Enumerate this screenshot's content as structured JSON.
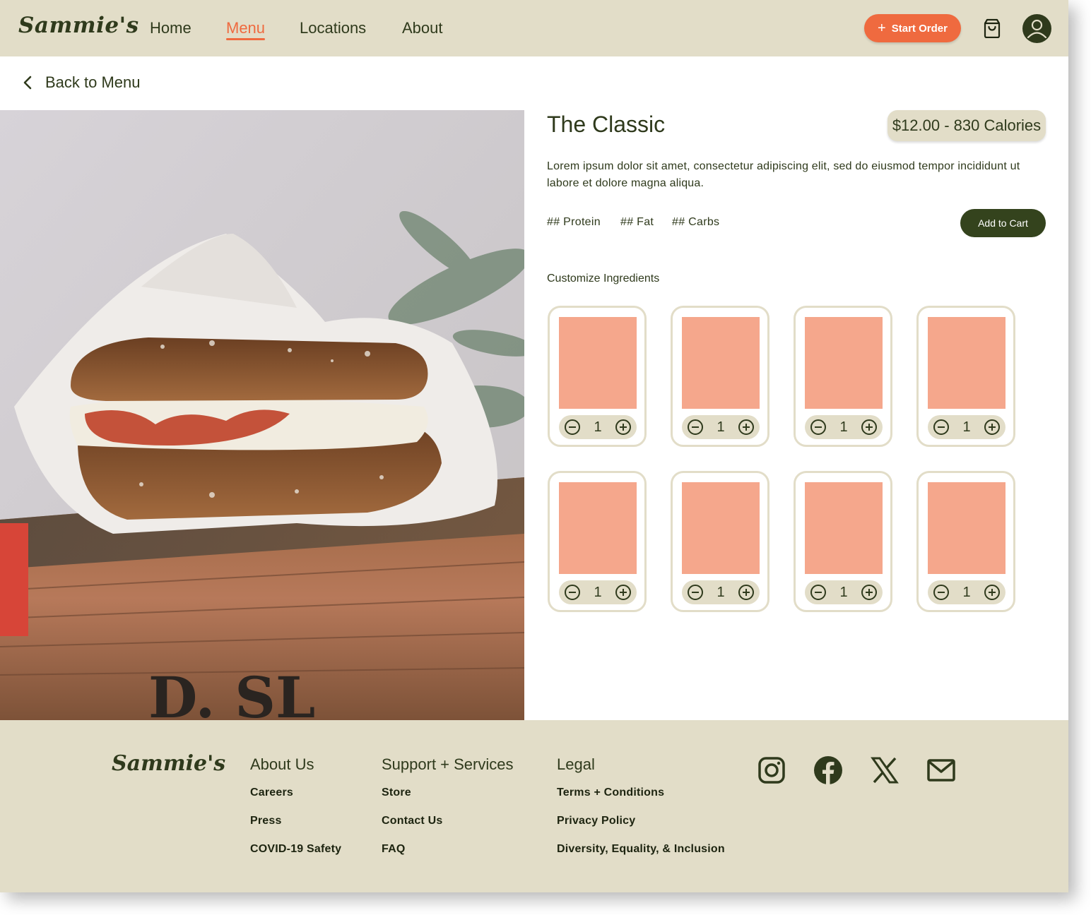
{
  "brand": {
    "name": "Sammie's"
  },
  "nav": {
    "links": [
      {
        "label": "Home",
        "active": false
      },
      {
        "label": "Menu",
        "active": true
      },
      {
        "label": "Locations",
        "active": false
      },
      {
        "label": "About",
        "active": false
      }
    ],
    "start_order_label": "Start Order",
    "cart_icon": "shopping-bag-icon",
    "profile_icon": "user-avatar-icon"
  },
  "back": {
    "label": "Back to Menu",
    "icon": "chevron-left-icon"
  },
  "product": {
    "image": "sandwich-photo",
    "title": "The Classic",
    "price_calories": "$12.00 - 830 Calories",
    "description": "Lorem ipsum dolor sit amet, consectetur adipiscing elit, sed do eiusmod tempor incididunt ut labore et dolore magna aliqua.",
    "macros": [
      "## Protein",
      "## Fat",
      "## Carbs"
    ],
    "add_to_cart_label": "Add to Cart"
  },
  "customize": {
    "heading": "Customize Ingredients",
    "ingredients": [
      {
        "qty": "1"
      },
      {
        "qty": "1"
      },
      {
        "qty": "1"
      },
      {
        "qty": "1"
      },
      {
        "qty": "1"
      },
      {
        "qty": "1"
      },
      {
        "qty": "1"
      },
      {
        "qty": "1"
      }
    ]
  },
  "footer": {
    "logo": "Sammie's",
    "columns": [
      {
        "heading": "About Us",
        "links": [
          "Careers",
          "Press",
          "COVID-19 Safety"
        ]
      },
      {
        "heading": "Support + Services",
        "links": [
          "Store",
          "Contact Us",
          "FAQ"
        ]
      },
      {
        "heading": "Legal",
        "links": [
          "Terms + Conditions",
          "Privacy Policy",
          "Diversity, Equality, & Inclusion"
        ]
      }
    ],
    "social": [
      "instagram-icon",
      "facebook-icon",
      "x-icon",
      "mail-icon"
    ]
  },
  "colors": {
    "accent": "#ef6a3f",
    "primary_dark": "#34431d",
    "beige": "#e2ddc8",
    "placeholder": "#f5a78c"
  }
}
